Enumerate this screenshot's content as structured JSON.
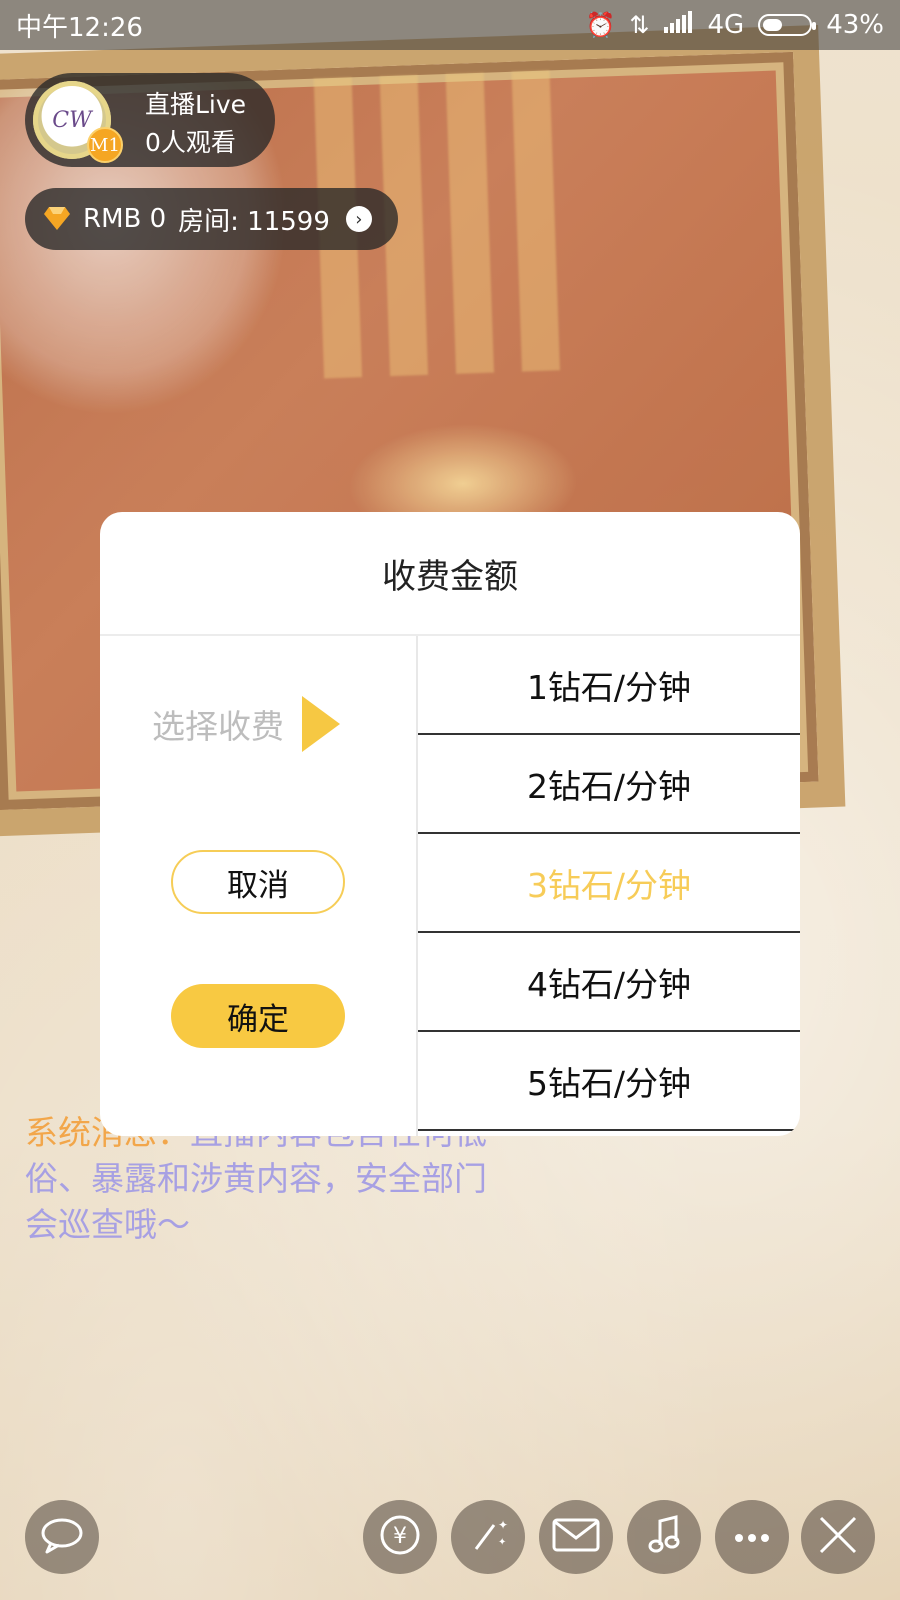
{
  "status_bar": {
    "time": "中午12:26",
    "network": "4G",
    "battery_percent": "43%",
    "battery_level": 0.43,
    "icons": [
      "alarm-icon",
      "data-transfer-icon",
      "signal-icon",
      "battery-icon"
    ]
  },
  "host": {
    "name": "直播Live",
    "viewers": "0人观看",
    "level": "M1"
  },
  "room": {
    "currency": "RMB",
    "balance": "0",
    "room_label": "房间: 11599",
    "diamond_color": "#f5a623"
  },
  "system_message": {
    "label": "系统消息：",
    "text": "直播内容包含任何低俗、暴露和涉黄内容，安全部门会巡查哦～"
  },
  "modal": {
    "title": "收费金额",
    "select_label": "选择收费",
    "cancel_label": "取消",
    "confirm_label": "确定",
    "options": [
      {
        "label": "1钻石/分钟",
        "selected": false
      },
      {
        "label": "2钻石/分钟",
        "selected": false
      },
      {
        "label": "3钻石/分钟",
        "selected": true
      },
      {
        "label": "4钻石/分钟",
        "selected": false
      },
      {
        "label": "5钻石/分钟",
        "selected": false
      }
    ],
    "accent_color": "#f8c942"
  },
  "bottom_bar": {
    "buttons": [
      "chat-icon",
      "yuan-icon",
      "magic-wand-icon",
      "mail-icon",
      "music-icon",
      "more-icon",
      "close-icon"
    ]
  }
}
